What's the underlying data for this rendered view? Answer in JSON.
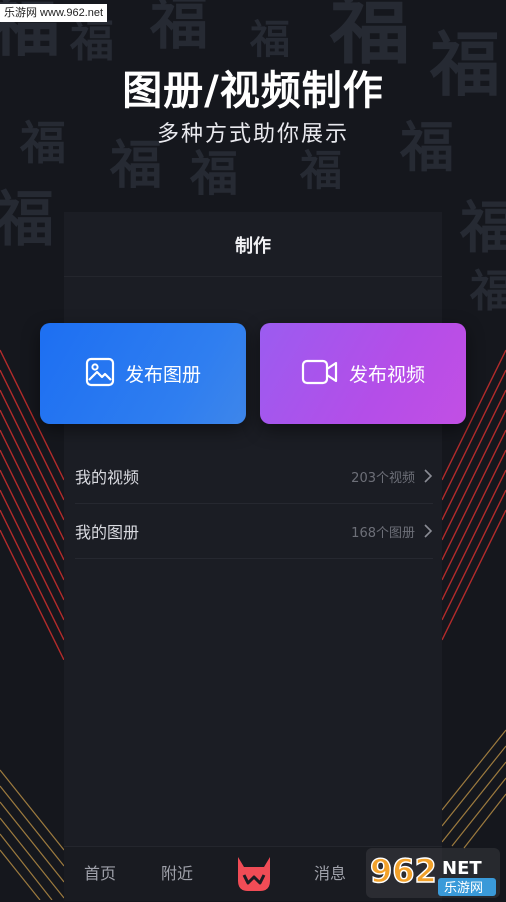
{
  "watermark_top": "乐游网 www.962.net",
  "headline": {
    "title": "图册/视频制作",
    "subtitle": "多种方式助你展示"
  },
  "panel": {
    "title": "制作",
    "buttons": [
      {
        "label": "发布图册",
        "icon": "image-icon",
        "color": "#2a78f0"
      },
      {
        "label": "发布视频",
        "icon": "video-camera-icon",
        "color": "#b04ee8"
      }
    ],
    "rows": [
      {
        "label": "我的视频",
        "count": "203个视频"
      },
      {
        "label": "我的图册",
        "count": "168个图册"
      }
    ]
  },
  "tabbar": {
    "home": "首页",
    "nearby": "附近",
    "messages": "消息",
    "center_icon": "horned-logo-icon"
  },
  "watermark_bottom": {
    "brand": "962",
    "suffix": "NET",
    "site_name": "乐游网"
  },
  "background_char": "福"
}
